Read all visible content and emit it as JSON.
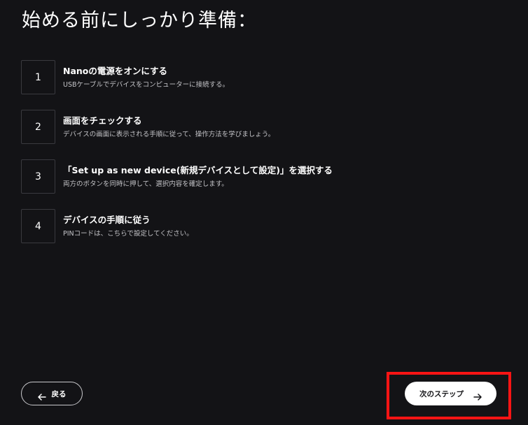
{
  "page": {
    "title": "始める前にしっかり準備："
  },
  "steps": [
    {
      "number": "1",
      "title": "Nanoの電源をオンにする",
      "description": "USBケーブルでデバイスをコンピューターに接続する。"
    },
    {
      "number": "2",
      "title": "画面をチェックする",
      "description": "デバイスの画面に表示される手順に従って、操作方法を学びましょう。"
    },
    {
      "number": "3",
      "title": "「Set up as new device(新規デバイスとして設定)」を選択する",
      "description": "両方のボタンを同時に押して、選択内容を確定します。"
    },
    {
      "number": "4",
      "title": "デバイスの手順に従う",
      "description": "PINコードは、こちらで設定してください。"
    }
  ],
  "footer": {
    "back_label": "戻る",
    "back_icon": "arrow-left-icon",
    "next_label": "次のステップ",
    "next_icon": "arrow-right-icon"
  },
  "colors": {
    "background": "#131316",
    "highlight": "#ff1414",
    "next_button": "#ffffff"
  }
}
